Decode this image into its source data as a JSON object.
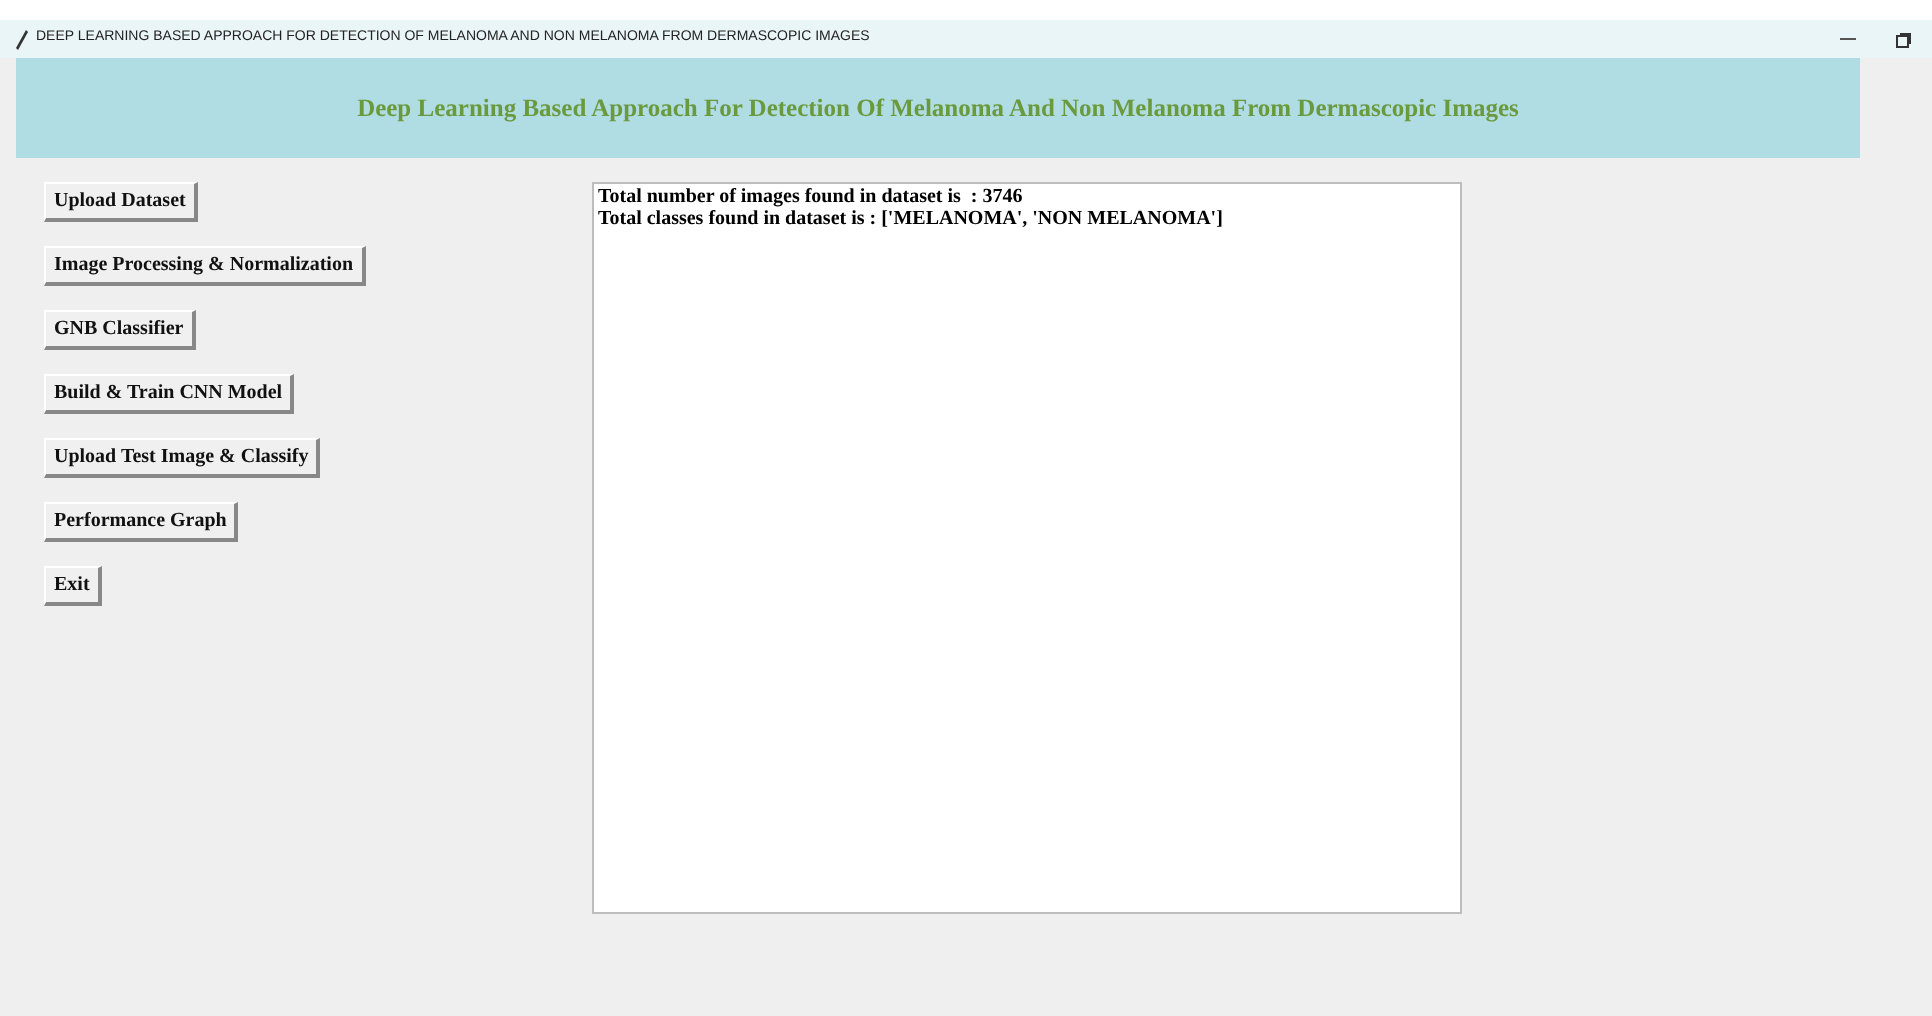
{
  "window": {
    "title": "DEEP LEARNING BASED APPROACH FOR DETECTION OF MELANOMA AND NON MELANOMA FROM DERMASCOPIC IMAGES"
  },
  "header": {
    "title": "Deep Learning Based Approach For Detection Of Melanoma And Non Melanoma From Dermascopic Images"
  },
  "buttons": [
    "Upload Dataset",
    "Image Processing & Normalization",
    "GNB Classifier",
    "Build & Train CNN Model",
    "Upload Test Image & Classify",
    "Performance Graph",
    "Exit"
  ],
  "output": {
    "lines": [
      "Total number of images found in dataset is  : 3746",
      "Total classes found in dataset is : ['MELANOMA', 'NON MELANOMA']"
    ]
  }
}
